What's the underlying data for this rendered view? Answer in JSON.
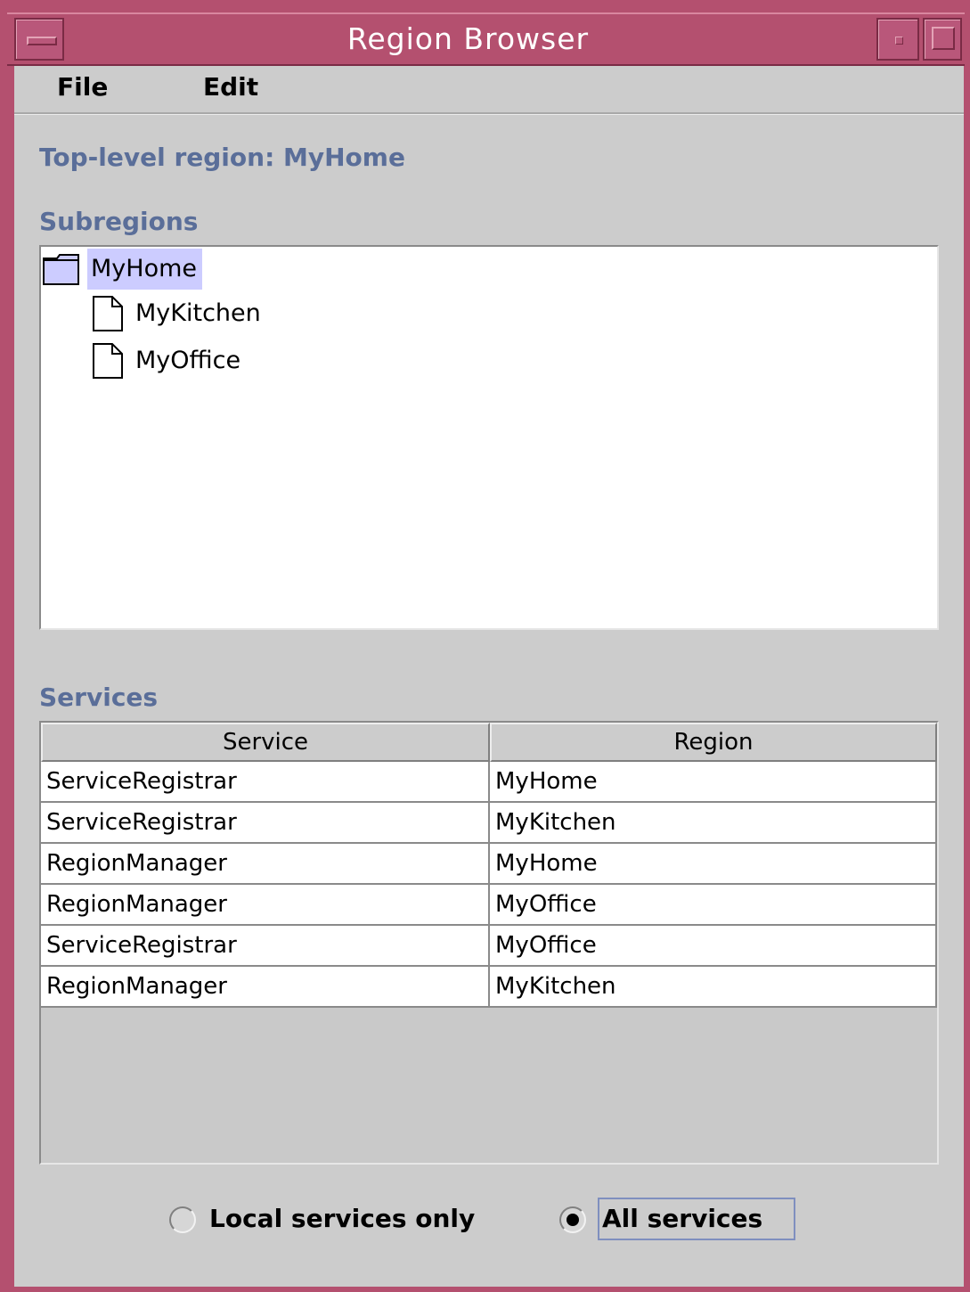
{
  "window": {
    "title": "Region Browser"
  },
  "menubar": {
    "file": "File",
    "edit": "Edit"
  },
  "top_level": "Top-level region: MyHome",
  "subregions": {
    "heading": "Subregions",
    "root": "MyHome",
    "children": [
      "MyKitchen",
      "MyOffice"
    ]
  },
  "services": {
    "heading": "Services",
    "columns": [
      "Service",
      "Region"
    ],
    "rows": [
      [
        "ServiceRegistrar",
        "MyHome"
      ],
      [
        "ServiceRegistrar",
        "MyKitchen"
      ],
      [
        "RegionManager",
        "MyHome"
      ],
      [
        "RegionManager",
        "MyOffice"
      ],
      [
        "ServiceRegistrar",
        "MyOffice"
      ],
      [
        "RegionManager",
        "MyKitchen"
      ]
    ]
  },
  "filter": {
    "local": "Local services only",
    "all": "All services",
    "selected": "all"
  },
  "colors": {
    "titlebar": "#b4506f",
    "heading": "#5a6e99",
    "selection": "#ccccff"
  }
}
